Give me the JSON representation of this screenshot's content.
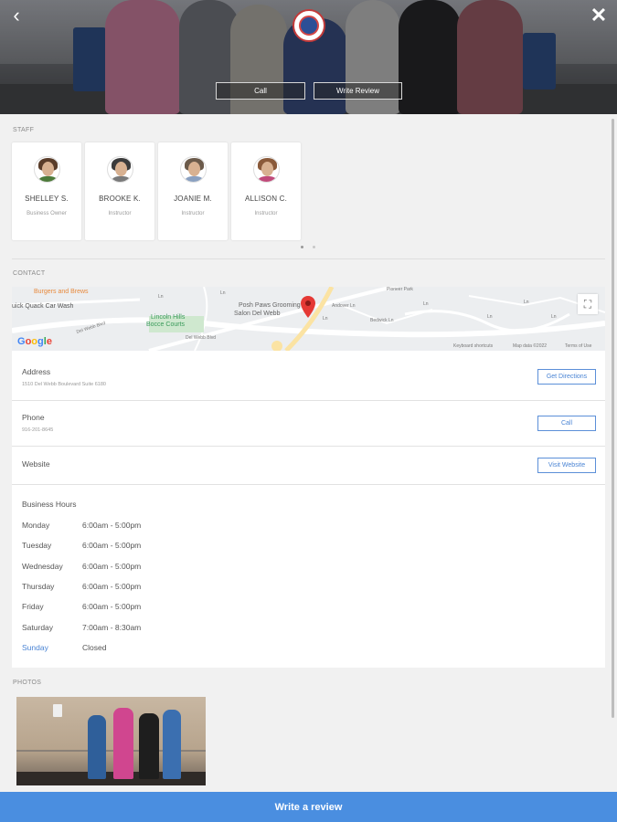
{
  "hero": {
    "call_label": "Call",
    "write_review_label": "Write Review"
  },
  "staff": {
    "section_label": "STAFF",
    "members": [
      {
        "name": "SHELLEY S.",
        "role": "Business Owner",
        "hair": "#5a3d2a",
        "shirt": "#4d7a3a"
      },
      {
        "name": "BROOKE K.",
        "role": "Instructor",
        "hair": "#3b3b3b",
        "shirt": "#7a7a7a"
      },
      {
        "name": "JOANIE M.",
        "role": "Instructor",
        "hair": "#6b5a4a",
        "shirt": "#8aa0c0"
      },
      {
        "name": "ALLISON C.",
        "role": "Instructor",
        "hair": "#8a5a3a",
        "shirt": "#c04a7a"
      }
    ]
  },
  "contact": {
    "section_label": "CONTACT",
    "map": {
      "place_burgers": "Burgers and Brews",
      "place_carwash": "uick Quack Car Wash",
      "place_posh": "Posh Paws Grooming",
      "place_posh2": "Salon Del Webb",
      "place_park": "Lincoln Hills",
      "place_park2": "Bocce Courts",
      "street_delwebb": "Del Webb Blvd",
      "street_delwebb2": "Del Webb Blvd",
      "street_andover": "Andover Ln",
      "street_bedwick": "Bedwick Ln",
      "street_pioneer": "Pioneer Park",
      "street_sm1": "Ln",
      "street_sm2": "Ln",
      "street_sm3": "Ln",
      "street_sm4": "Ln",
      "street_sm5": "Ln",
      "street_sm6": "Ln",
      "street_sm7": "Ln",
      "keyboard": "Keyboard shortcuts",
      "mapdata": "Map data ©2022",
      "terms": "Terms of Use",
      "google": "Google"
    },
    "address": {
      "title": "Address",
      "value": "1510 Del Webb Boulevard Suite 6180",
      "button": "Get Directions"
    },
    "phone": {
      "title": "Phone",
      "value": "916-201-8645",
      "button": "Call"
    },
    "website": {
      "title": "Website",
      "button": "Visit Website"
    }
  },
  "hours": {
    "title": "Business Hours",
    "days": [
      {
        "day": "Monday",
        "time": "6:00am - 5:00pm"
      },
      {
        "day": "Tuesday",
        "time": "6:00am - 5:00pm"
      },
      {
        "day": "Wednesday",
        "time": "6:00am - 5:00pm"
      },
      {
        "day": "Thursday",
        "time": "6:00am - 5:00pm"
      },
      {
        "day": "Friday",
        "time": "6:00am - 5:00pm"
      },
      {
        "day": "Saturday",
        "time": "7:00am - 8:30am"
      },
      {
        "day": "Sunday",
        "time": "Closed"
      }
    ]
  },
  "photos": {
    "section_label": "PHOTOS"
  },
  "bottom": {
    "write_review_label": "Write a review"
  },
  "colors": {
    "accent": "#4a8ee0",
    "map_pin": "#e53935"
  }
}
